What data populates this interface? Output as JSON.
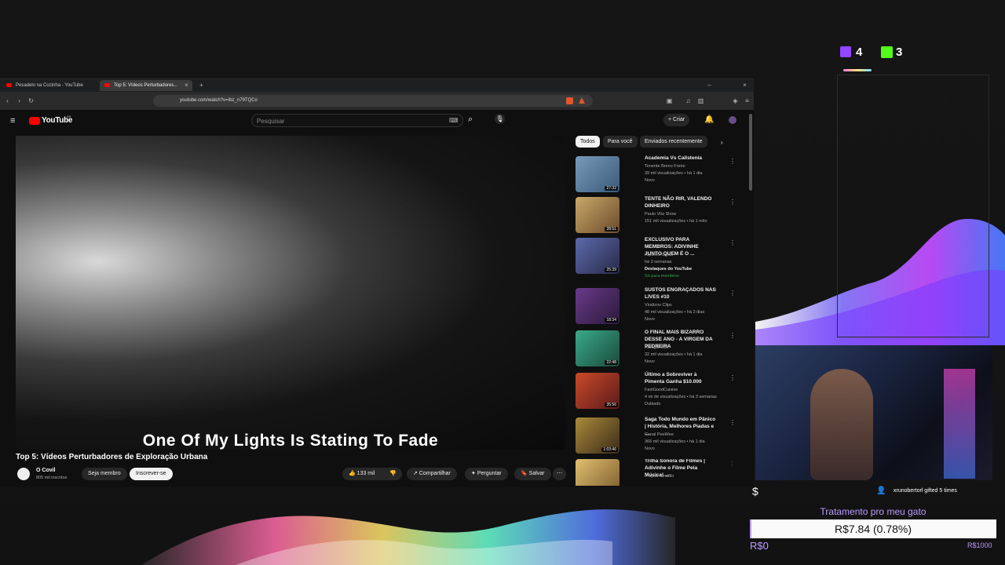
{
  "overlay": {
    "twitch_count": "4",
    "kick_count": "3",
    "gift_text": "xrunobertorl gifted 5 times",
    "goal_title": "Tratamento pro meu gato",
    "goal_progress_text": "R$7.84 (0.78%)",
    "goal_progress_fraction": 0.0078,
    "goal_min": "R$0",
    "goal_max": "R$1000"
  },
  "browser": {
    "tabs": [
      {
        "label": "Pesadelo na Cozinha - YouTube"
      },
      {
        "label": "Top 5: Vídeos Perturbadores..."
      }
    ],
    "url": "youtube.com/watch?v=Ibz_n79TQCo"
  },
  "youtube": {
    "logo": "YouTube",
    "logo_sup": "BR",
    "search_placeholder": "Pesquisar",
    "create_label": "Criar",
    "subtitle": "One Of My Lights Is Stating To Fade",
    "video_title": "Top 5: Vídeos Perturbadores de Exploração Urbana",
    "channel_name": "O Covil",
    "channel_subs": "805 mil inscritos",
    "member_label": "Seja membro",
    "subscribe_label": "Inscrever-se",
    "likes": "133 mil",
    "share_label": "Compartilhar",
    "ask_label": "Perguntar",
    "save_label": "Salvar",
    "chips": [
      "Todos",
      "Para você",
      "Enviados recentemente"
    ],
    "recommendations": [
      {
        "title": "Academia Vs Calistenia",
        "channel": "Tenente Breno Freire",
        "meta": "39 mil visualizações • há 1 dia",
        "badge": "Novo",
        "duration": "27:32",
        "color": "#4a6a8a"
      },
      {
        "title": "TENTE NÃO RIR, VALENDO DINHEIRO",
        "channel": "Paulo Vita Show",
        "meta": "151 mil visualizações • há 1 mês",
        "badge": "",
        "duration": "28:51",
        "color": "#6a5a3a"
      },
      {
        "title": "EXCLUSIVO PARA MEMBROS: ADIVINHE JUNTO QUEM É O ...",
        "channel": "Aqueles Caras",
        "meta": "há 3 semanas",
        "badge": "Destaques do YouTube",
        "extra": "Só para membros",
        "duration": "25:39",
        "color": "#3a3a5a"
      },
      {
        "title": "SUSTOS ENGRAÇADOS NAS LIVES #10",
        "channel": "Viralizou Clips",
        "meta": "48 mil visualizações • há 3 dias",
        "badge": "Novo",
        "duration": "18:34",
        "color": "#3a2a4a"
      },
      {
        "title": "O FINAL MAIS BIZARRO DESSE ANO - A VIRGEM DA PEDREIRA",
        "channel": "Refúgio Cult",
        "meta": "32 mil visualizações • há 1 dia",
        "badge": "Novo",
        "duration": "22:48",
        "color": "#2a6a5a"
      },
      {
        "title": "Último a Sobreviver à Pimenta Ganha $10.000",
        "channel": "FastGoodCuisine",
        "meta": "4 mi de visualizações • há 3 semanas",
        "badge": "Dublado",
        "duration": "35:56",
        "color": "#8a3a2a"
      },
      {
        "title": "Saga Todo Mundo em Pânico | História, Melhores Piadas e ...",
        "channel": "Canal PeeWee",
        "meta": "366 mil visualizações • há 1 dia",
        "badge": "Novo",
        "duration": "1:03:46",
        "color": "#5a4a2a"
      },
      {
        "title": "Trilha Sonora de Filmes | Adivinhe o Filme Pela Música! ...",
        "channel": "Projeto Cinéfilo",
        "meta": "",
        "badge": "",
        "duration": "",
        "color": "#6a5a2a"
      }
    ]
  }
}
